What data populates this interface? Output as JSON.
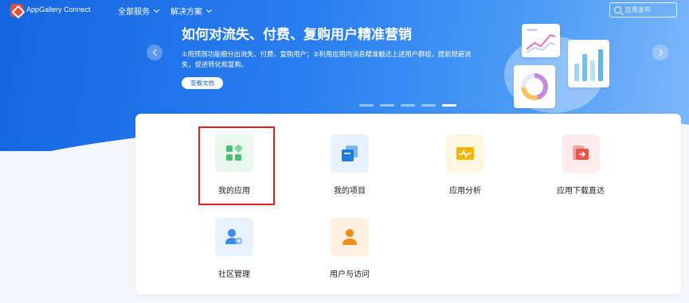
{
  "nav": {
    "brand": "AppGallery Connect",
    "menu": [
      {
        "label": "全部服务",
        "icon": "chevron-down-icon"
      },
      {
        "label": "解决方案",
        "icon": "chevron-down-icon"
      }
    ],
    "search": {
      "placeholder": "应用发布",
      "icon": "search-icon"
    }
  },
  "banner": {
    "title": "如何对流失、付费、复购用户精准营销",
    "description": "①用预测功能细分出流失、付费、复购用户；②利用应用内消息精准触达上述用户群组，提前规避流失，促进转化和复购。",
    "button_label": "查看文档",
    "slides_total": 5,
    "active_slide": 5
  },
  "services": [
    {
      "label": "我的应用",
      "icon": "my-apps-icon",
      "color": "#4bbf73",
      "bg": "#eaf8ee",
      "highlighted": true
    },
    {
      "label": "我的项目",
      "icon": "my-projects-icon",
      "color": "#1f7ae0",
      "bg": "#e8f2fd"
    },
    {
      "label": "应用分析",
      "icon": "app-analytics-icon",
      "color": "#f5b400",
      "bg": "#fff6e0"
    },
    {
      "label": "应用下载直达",
      "icon": "app-download-icon",
      "color": "#e8534a",
      "bg": "#fdeceb"
    },
    {
      "label": "社区管理",
      "icon": "community-management-icon",
      "color": "#3d8ce8",
      "bg": "#e8f2fd"
    },
    {
      "label": "用户与访问",
      "icon": "users-access-icon",
      "color": "#f08c1a",
      "bg": "#fff0e0"
    }
  ],
  "colors": {
    "highlight_border": "#e01f1f",
    "hero_blue": "#2a7ff0"
  }
}
